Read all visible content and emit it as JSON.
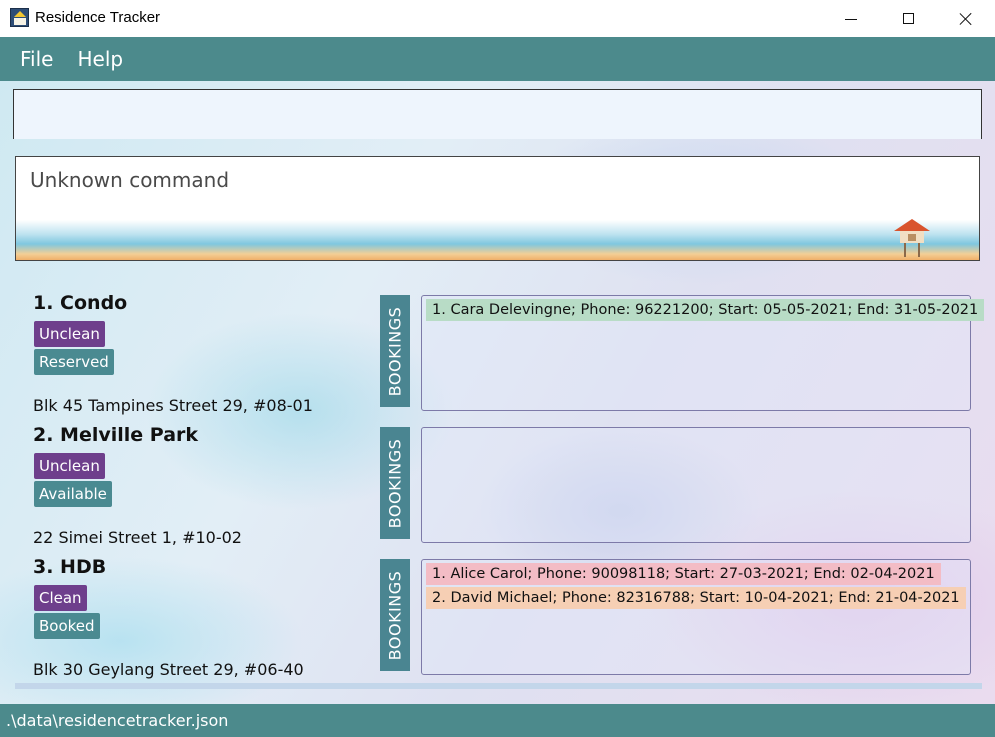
{
  "window": {
    "title": "Residence Tracker",
    "icon": "house-app-icon"
  },
  "menu": {
    "items": [
      {
        "label": "File"
      },
      {
        "label": "Help"
      }
    ]
  },
  "command": {
    "value": "",
    "placeholder": ""
  },
  "result": {
    "message": "Unknown command"
  },
  "bookings_header": "BOOKINGS",
  "residences": [
    {
      "title": "1.  Condo",
      "clean_tag": "Unclean",
      "status_tag": "Reserved",
      "address": "Blk 45 Tampines Street 29, #08-01",
      "bookings": [
        {
          "text": "1. Cara Delevingne; Phone: 96221200; Start: 05-05-2021; End: 31-05-2021",
          "color": "#b8dcc6"
        }
      ]
    },
    {
      "title": "2.  Melville Park",
      "clean_tag": "Unclean",
      "status_tag": "Available",
      "address": "22 Simei Street 1, #10-02",
      "bookings": []
    },
    {
      "title": "3.  HDB",
      "clean_tag": "Clean",
      "status_tag": "Booked",
      "address": "Blk 30 Geylang Street 29, #06-40",
      "bookings": [
        {
          "text": "1. Alice Carol; Phone: 90098118; Start: 27-03-2021; End: 02-04-2021",
          "color": "#f3bcc5"
        },
        {
          "text": "2. David Michael; Phone: 82316788; Start: 10-04-2021; End: 21-04-2021",
          "color": "#f6cfb4"
        }
      ]
    }
  ],
  "status": {
    "path": ".\\data\\residencetracker.json"
  },
  "colors": {
    "accent": "#4c8a8c",
    "clean_tag": "#6e3f8c",
    "status_tag": "#4a8a91",
    "bookings_label": "#4a8591"
  }
}
